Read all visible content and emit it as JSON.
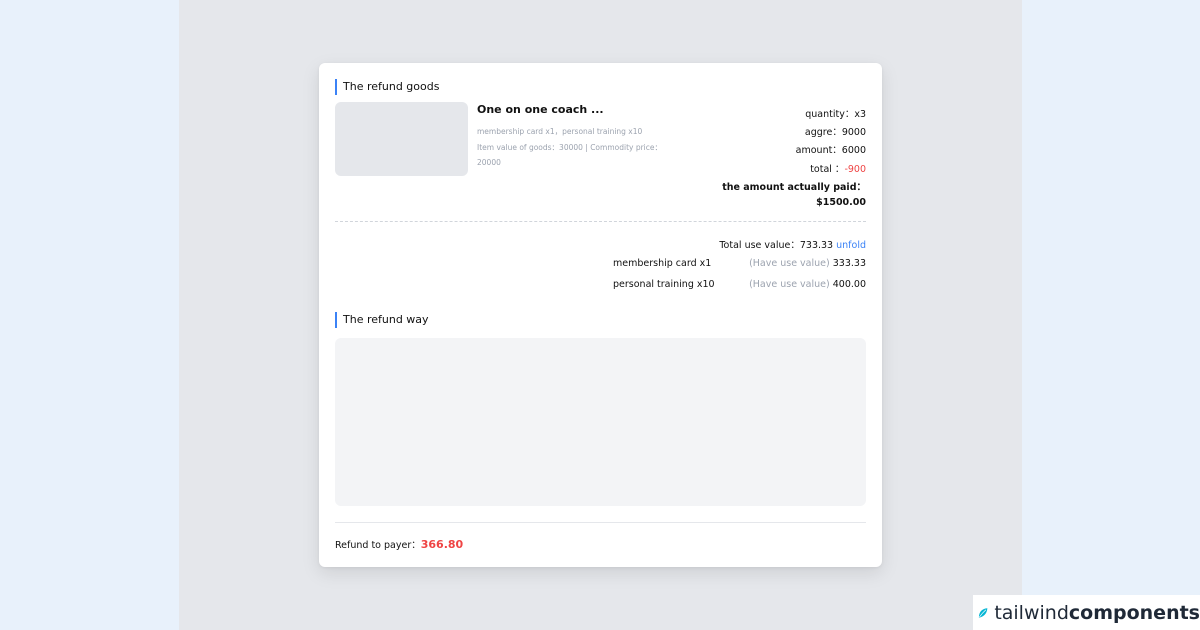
{
  "goods_section": {
    "title": "The refund goods"
  },
  "product": {
    "name": "One on one coach ...",
    "items_line": "membership card x1，personal training x10",
    "value_line_1": "Item value of goods：30000 | Commodity price：",
    "value_line_2": "20000"
  },
  "summary": {
    "quantity": "quantity：x3",
    "aggre": "aggre：9000",
    "amount": "amount：6000",
    "total_label": "total ：",
    "total_value": "-900",
    "paid_label": "the amount actually paid：",
    "paid_value": "$1500.00"
  },
  "usage": {
    "total_label": "Total use value：733.33",
    "unfold_link": "unfold",
    "rows": [
      {
        "name": "membership card x1",
        "hint": "(Have use value)",
        "value": "333.33"
      },
      {
        "name": "personal training x10",
        "hint": "(Have use value)",
        "value": "400.00"
      }
    ]
  },
  "way_section": {
    "title": "The refund way"
  },
  "refund": {
    "label": "Refund to payer：",
    "amount": "366.80"
  },
  "brand": {
    "light": "tailwind",
    "heavy": "components",
    "accent_color": "#06b6d4"
  }
}
